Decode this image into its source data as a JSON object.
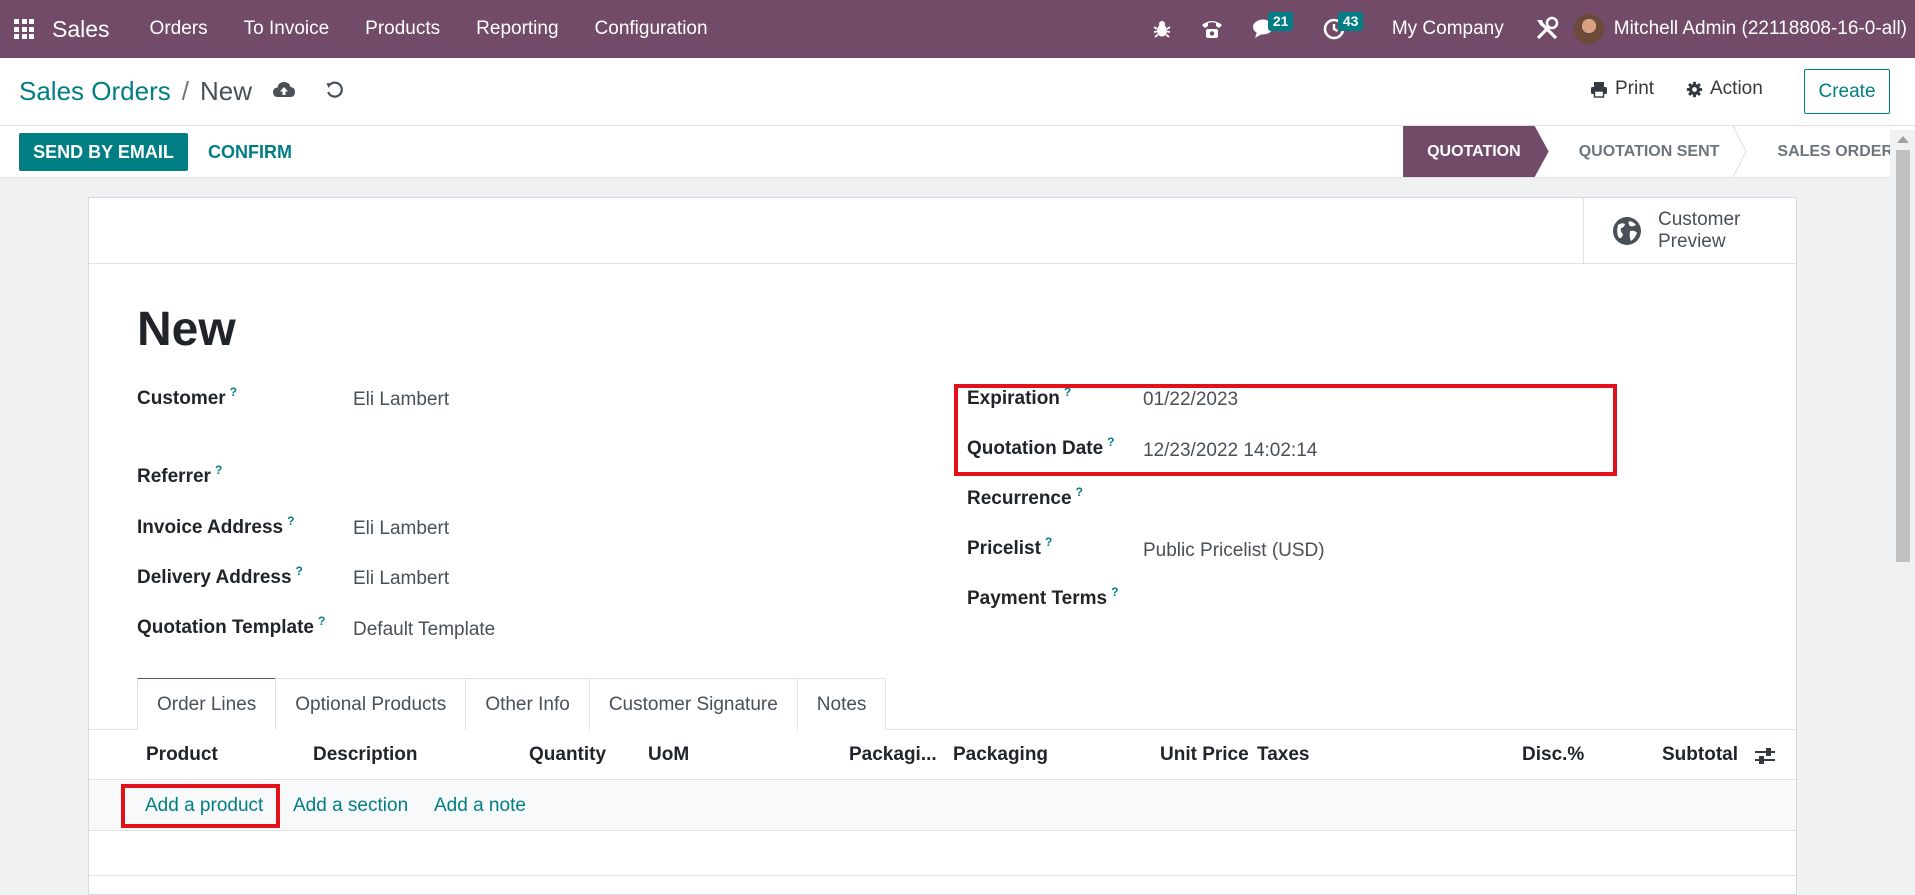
{
  "nav": {
    "brand": "Sales",
    "menu": [
      "Orders",
      "To Invoice",
      "Products",
      "Reporting",
      "Configuration"
    ],
    "messages_count": "21",
    "activities_count": "43",
    "company": "My Company",
    "user": "Mitchell Admin (22118808-16-0-all)"
  },
  "control": {
    "breadcrumb_parent": "Sales Orders",
    "breadcrumb_separator": "/",
    "breadcrumb_current": "New",
    "print_label": "Print",
    "action_label": "Action",
    "create_label": "Create"
  },
  "statusbar": {
    "send_label": "SEND BY EMAIL",
    "confirm_label": "CONFIRM",
    "stages": [
      "QUOTATION",
      "QUOTATION SENT",
      "SALES ORDER"
    ],
    "active_stage": "QUOTATION"
  },
  "sheet": {
    "preview_label": "Customer Preview",
    "title": "New",
    "left_fields": [
      {
        "label": "Customer",
        "value": "Eli Lambert"
      },
      {
        "label": "Referrer",
        "value": ""
      },
      {
        "label": "Invoice Address",
        "value": "Eli Lambert"
      },
      {
        "label": "Delivery Address",
        "value": "Eli Lambert"
      },
      {
        "label": "Quotation Template",
        "value": "Default Template"
      }
    ],
    "right_fields": [
      {
        "label": "Expiration",
        "value": "01/22/2023"
      },
      {
        "label": "Quotation Date",
        "value": "12/23/2022 14:02:14"
      },
      {
        "label": "Recurrence",
        "value": ""
      },
      {
        "label": "Pricelist",
        "value": "Public Pricelist (USD)"
      },
      {
        "label": "Payment Terms",
        "value": ""
      }
    ],
    "help_mark": "?",
    "tabs": [
      "Order Lines",
      "Optional Products",
      "Other Info",
      "Customer Signature",
      "Notes"
    ],
    "columns": [
      "Product",
      "Description",
      "Quantity",
      "UoM",
      "Packagi...",
      "Packaging",
      "Unit Price",
      "Taxes",
      "Disc.%",
      "Subtotal"
    ],
    "add_links": [
      "Add a product",
      "Add a section",
      "Add a note"
    ]
  },
  "colors": {
    "brand": "#714b67",
    "accent": "#017e84",
    "highlight": "#e3111b"
  }
}
